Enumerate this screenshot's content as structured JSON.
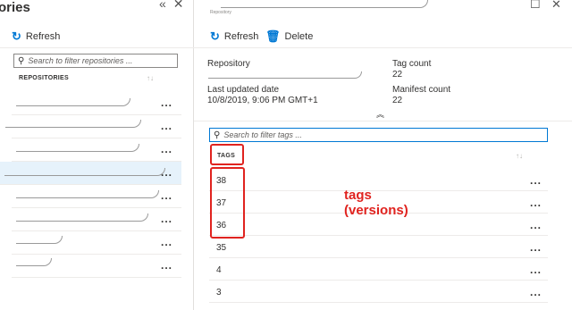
{
  "left_blade": {
    "title": "ories",
    "refresh_label": "Refresh",
    "filter_placeholder": "Search to filter repositories ...",
    "column_header": "REPOSITORIES",
    "row_menu": "..."
  },
  "right_blade": {
    "top_caption": "Repository",
    "refresh_label": "Refresh",
    "delete_label": "Delete",
    "essentials": {
      "repository_label": "Repository",
      "tag_count_label": "Tag count",
      "tag_count_value": "22",
      "last_updated_label": "Last updated date",
      "last_updated_value": "10/8/2019, 9:06 PM GMT+1",
      "manifest_count_label": "Manifest count",
      "manifest_count_value": "22"
    },
    "tag_filter_placeholder": "Search to filter tags ...",
    "tags_header": "TAGS",
    "tags": [
      "38",
      "37",
      "36",
      "35",
      "4",
      "3"
    ],
    "row_menu": "..."
  },
  "annotation": {
    "line1": "tags",
    "line2": "(versions)"
  },
  "icons": {
    "collapse": "double-chevron-left-icon",
    "close": "close-icon",
    "maximize": "maximize-icon",
    "refresh": "refresh-icon",
    "delete": "trash-icon",
    "search": "search-icon",
    "expand": "double-chevron-up-icon",
    "sort": "sort-icon"
  },
  "colors": {
    "accent": "#0078d4",
    "annotation_red": "#e0231f",
    "selected_row": "#e6f2fb"
  }
}
